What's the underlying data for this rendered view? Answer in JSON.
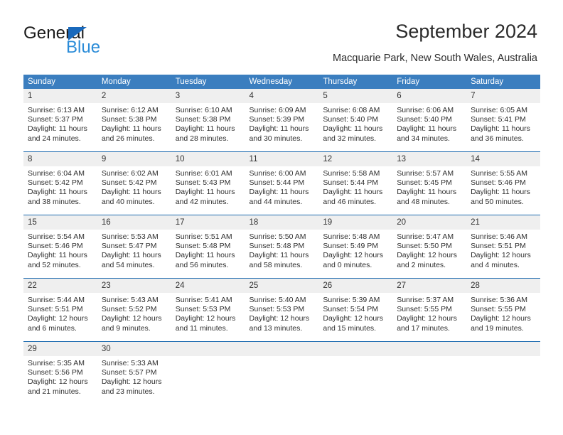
{
  "brand": {
    "name_part1": "General",
    "name_part2": "Blue",
    "flag_color": "#1969bc",
    "blue_text_color": "#2b8cd8"
  },
  "header": {
    "title": "September 2024",
    "subtitle": "Macquarie Park, New South Wales, Australia"
  },
  "theme": {
    "header_row_bg": "#3b7ebf",
    "header_row_text": "#ffffff",
    "date_band_bg": "#efefef",
    "week_divider": "#1f6cb0",
    "cell_bg": "#ffffff",
    "body_text": "#2f2f2f"
  },
  "calendar": {
    "day_headers": [
      "Sunday",
      "Monday",
      "Tuesday",
      "Wednesday",
      "Thursday",
      "Friday",
      "Saturday"
    ],
    "weeks": [
      [
        {
          "day": "1",
          "sunrise": "Sunrise: 6:13 AM",
          "sunset": "Sunset: 5:37 PM",
          "daylight": "Daylight: 11 hours and 24 minutes."
        },
        {
          "day": "2",
          "sunrise": "Sunrise: 6:12 AM",
          "sunset": "Sunset: 5:38 PM",
          "daylight": "Daylight: 11 hours and 26 minutes."
        },
        {
          "day": "3",
          "sunrise": "Sunrise: 6:10 AM",
          "sunset": "Sunset: 5:38 PM",
          "daylight": "Daylight: 11 hours and 28 minutes."
        },
        {
          "day": "4",
          "sunrise": "Sunrise: 6:09 AM",
          "sunset": "Sunset: 5:39 PM",
          "daylight": "Daylight: 11 hours and 30 minutes."
        },
        {
          "day": "5",
          "sunrise": "Sunrise: 6:08 AM",
          "sunset": "Sunset: 5:40 PM",
          "daylight": "Daylight: 11 hours and 32 minutes."
        },
        {
          "day": "6",
          "sunrise": "Sunrise: 6:06 AM",
          "sunset": "Sunset: 5:40 PM",
          "daylight": "Daylight: 11 hours and 34 minutes."
        },
        {
          "day": "7",
          "sunrise": "Sunrise: 6:05 AM",
          "sunset": "Sunset: 5:41 PM",
          "daylight": "Daylight: 11 hours and 36 minutes."
        }
      ],
      [
        {
          "day": "8",
          "sunrise": "Sunrise: 6:04 AM",
          "sunset": "Sunset: 5:42 PM",
          "daylight": "Daylight: 11 hours and 38 minutes."
        },
        {
          "day": "9",
          "sunrise": "Sunrise: 6:02 AM",
          "sunset": "Sunset: 5:42 PM",
          "daylight": "Daylight: 11 hours and 40 minutes."
        },
        {
          "day": "10",
          "sunrise": "Sunrise: 6:01 AM",
          "sunset": "Sunset: 5:43 PM",
          "daylight": "Daylight: 11 hours and 42 minutes."
        },
        {
          "day": "11",
          "sunrise": "Sunrise: 6:00 AM",
          "sunset": "Sunset: 5:44 PM",
          "daylight": "Daylight: 11 hours and 44 minutes."
        },
        {
          "day": "12",
          "sunrise": "Sunrise: 5:58 AM",
          "sunset": "Sunset: 5:44 PM",
          "daylight": "Daylight: 11 hours and 46 minutes."
        },
        {
          "day": "13",
          "sunrise": "Sunrise: 5:57 AM",
          "sunset": "Sunset: 5:45 PM",
          "daylight": "Daylight: 11 hours and 48 minutes."
        },
        {
          "day": "14",
          "sunrise": "Sunrise: 5:55 AM",
          "sunset": "Sunset: 5:46 PM",
          "daylight": "Daylight: 11 hours and 50 minutes."
        }
      ],
      [
        {
          "day": "15",
          "sunrise": "Sunrise: 5:54 AM",
          "sunset": "Sunset: 5:46 PM",
          "daylight": "Daylight: 11 hours and 52 minutes."
        },
        {
          "day": "16",
          "sunrise": "Sunrise: 5:53 AM",
          "sunset": "Sunset: 5:47 PM",
          "daylight": "Daylight: 11 hours and 54 minutes."
        },
        {
          "day": "17",
          "sunrise": "Sunrise: 5:51 AM",
          "sunset": "Sunset: 5:48 PM",
          "daylight": "Daylight: 11 hours and 56 minutes."
        },
        {
          "day": "18",
          "sunrise": "Sunrise: 5:50 AM",
          "sunset": "Sunset: 5:48 PM",
          "daylight": "Daylight: 11 hours and 58 minutes."
        },
        {
          "day": "19",
          "sunrise": "Sunrise: 5:48 AM",
          "sunset": "Sunset: 5:49 PM",
          "daylight": "Daylight: 12 hours and 0 minutes."
        },
        {
          "day": "20",
          "sunrise": "Sunrise: 5:47 AM",
          "sunset": "Sunset: 5:50 PM",
          "daylight": "Daylight: 12 hours and 2 minutes."
        },
        {
          "day": "21",
          "sunrise": "Sunrise: 5:46 AM",
          "sunset": "Sunset: 5:51 PM",
          "daylight": "Daylight: 12 hours and 4 minutes."
        }
      ],
      [
        {
          "day": "22",
          "sunrise": "Sunrise: 5:44 AM",
          "sunset": "Sunset: 5:51 PM",
          "daylight": "Daylight: 12 hours and 6 minutes."
        },
        {
          "day": "23",
          "sunrise": "Sunrise: 5:43 AM",
          "sunset": "Sunset: 5:52 PM",
          "daylight": "Daylight: 12 hours and 9 minutes."
        },
        {
          "day": "24",
          "sunrise": "Sunrise: 5:41 AM",
          "sunset": "Sunset: 5:53 PM",
          "daylight": "Daylight: 12 hours and 11 minutes."
        },
        {
          "day": "25",
          "sunrise": "Sunrise: 5:40 AM",
          "sunset": "Sunset: 5:53 PM",
          "daylight": "Daylight: 12 hours and 13 minutes."
        },
        {
          "day": "26",
          "sunrise": "Sunrise: 5:39 AM",
          "sunset": "Sunset: 5:54 PM",
          "daylight": "Daylight: 12 hours and 15 minutes."
        },
        {
          "day": "27",
          "sunrise": "Sunrise: 5:37 AM",
          "sunset": "Sunset: 5:55 PM",
          "daylight": "Daylight: 12 hours and 17 minutes."
        },
        {
          "day": "28",
          "sunrise": "Sunrise: 5:36 AM",
          "sunset": "Sunset: 5:55 PM",
          "daylight": "Daylight: 12 hours and 19 minutes."
        }
      ],
      [
        {
          "day": "29",
          "sunrise": "Sunrise: 5:35 AM",
          "sunset": "Sunset: 5:56 PM",
          "daylight": "Daylight: 12 hours and 21 minutes."
        },
        {
          "day": "30",
          "sunrise": "Sunrise: 5:33 AM",
          "sunset": "Sunset: 5:57 PM",
          "daylight": "Daylight: 12 hours and 23 minutes."
        },
        {
          "day": "",
          "sunrise": "",
          "sunset": "",
          "daylight": ""
        },
        {
          "day": "",
          "sunrise": "",
          "sunset": "",
          "daylight": ""
        },
        {
          "day": "",
          "sunrise": "",
          "sunset": "",
          "daylight": ""
        },
        {
          "day": "",
          "sunrise": "",
          "sunset": "",
          "daylight": ""
        },
        {
          "day": "",
          "sunrise": "",
          "sunset": "",
          "daylight": ""
        }
      ]
    ]
  }
}
